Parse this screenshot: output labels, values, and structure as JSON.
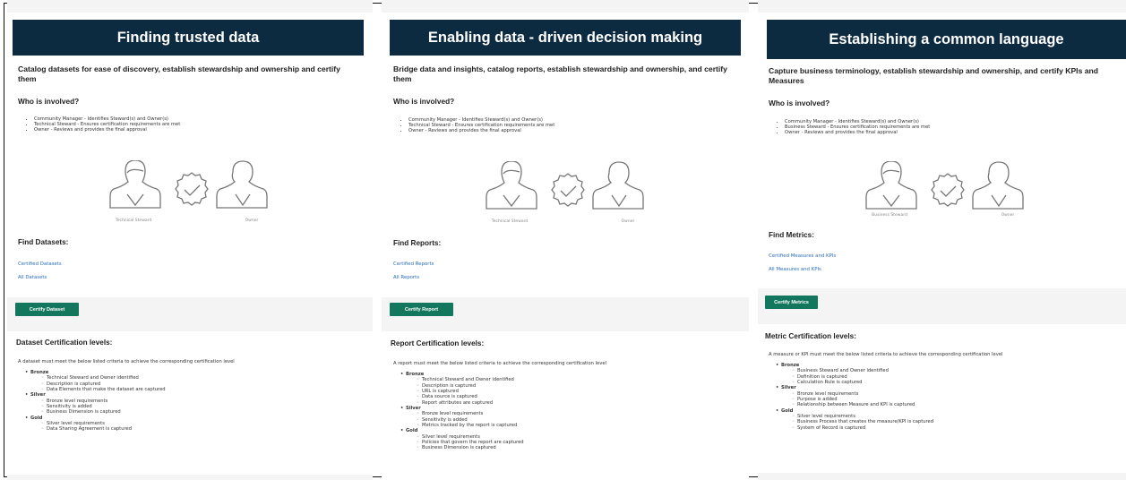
{
  "panels": [
    {
      "title": "Finding trusted data",
      "subtitle": "Catalog datasets for ease of discovery, establish stewardship and ownership and certify them",
      "who_label": "Who is involved?",
      "roles": [
        "Community Manager - Identifies Steward(s) and Owner(s)",
        "Technical Steward - Ensures certification requirements are met",
        "Owner - Reviews and provides the final approval"
      ],
      "steward_caption": "Technical Steward",
      "owner_caption": "Owner",
      "find_label": "Find Datasets:",
      "links": [
        "Certified Datasets",
        "All Datasets"
      ],
      "button_label": "Certify Dataset",
      "levels_label": "Dataset Certification levels:",
      "intro": "A dataset must meet the below listed criteria to achieve the corresponding certification level",
      "levels": [
        {
          "name": "Bronze",
          "items": [
            "Technical Steward and Owner identified",
            "Description is captured",
            "Data Elements that make the dataset are captured"
          ]
        },
        {
          "name": "Silver",
          "items": [
            "Bronze level requirements",
            "Sensitivity is added",
            "Business Dimension is captured"
          ]
        },
        {
          "name": "Gold",
          "items": [
            "Silver level requirements",
            "Data Sharing Agreement is captured"
          ]
        }
      ]
    },
    {
      "title": "Enabling data - driven decision making",
      "subtitle": "Bridge data and insights, catalog reports, establish stewardship and ownership, and certify them",
      "who_label": "Who is involved?",
      "roles": [
        "Community Manager - Identifies Steward(s) and Owner(s)",
        "Technical Steward - Ensures certification requirements are met",
        "Owner - Reviews and provides the final approval"
      ],
      "steward_caption": "Technical Steward",
      "owner_caption": "Owner",
      "find_label": "Find Reports:",
      "links": [
        "Certified Reports",
        "All Reports"
      ],
      "button_label": "Certify Report",
      "levels_label": "Report Certification levels:",
      "intro": "A report must meet the below listed criteria to achieve the corresponding certification level",
      "levels": [
        {
          "name": "Bronze",
          "items": [
            "Technical Steward and Owner identified",
            "Description is captured",
            "URL is captured",
            "Data source is captured",
            "Report attributes are captured"
          ]
        },
        {
          "name": "Silver",
          "items": [
            "Bronze level requirements",
            "Sensitivity is added",
            "Metrics tracked by the report is captured"
          ]
        },
        {
          "name": "Gold",
          "items": [
            "Silver level requirements",
            "Policies that govern the report are captured",
            "Business Dimension is captured"
          ]
        }
      ]
    },
    {
      "title": "Establishing a common language",
      "subtitle": "Capture business terminology, establish stewardship and ownership, and certify KPIs and Measures",
      "who_label": "Who is involved?",
      "roles": [
        "Community Manager - Identifies Steward(s) and Owner(s)",
        "Business Steward - Ensures certification requirements are met",
        "Owner - Reviews and provides the final approval"
      ],
      "steward_caption": "Business Steward",
      "owner_caption": "Owner",
      "find_label": "Find Metrics:",
      "links": [
        "Certified Measures and KPIs",
        "All Measures and KPIs"
      ],
      "button_label": "Certify Metrics",
      "levels_label": "Metric Certification levels:",
      "intro": "A measure or KPI must meet the below listed criteria to achieve the corresponding certification level",
      "levels": [
        {
          "name": "Bronze",
          "items": [
            "Business Steward and Owner identified",
            "Definition is captured",
            "Calculation Rule is captured"
          ]
        },
        {
          "name": "Silver",
          "items": [
            "Bronze level requirements",
            "Purpose is added",
            "Relationship between Measure and KPI is captured"
          ]
        },
        {
          "name": "Gold",
          "items": [
            "Silver level requirements",
            "Business Process that creates the measure/KPI is captured",
            "System of Record is captured"
          ]
        }
      ]
    }
  ],
  "colors": {
    "banner": "#0d2b40",
    "button": "#13775e",
    "link": "#2a6ebb"
  }
}
